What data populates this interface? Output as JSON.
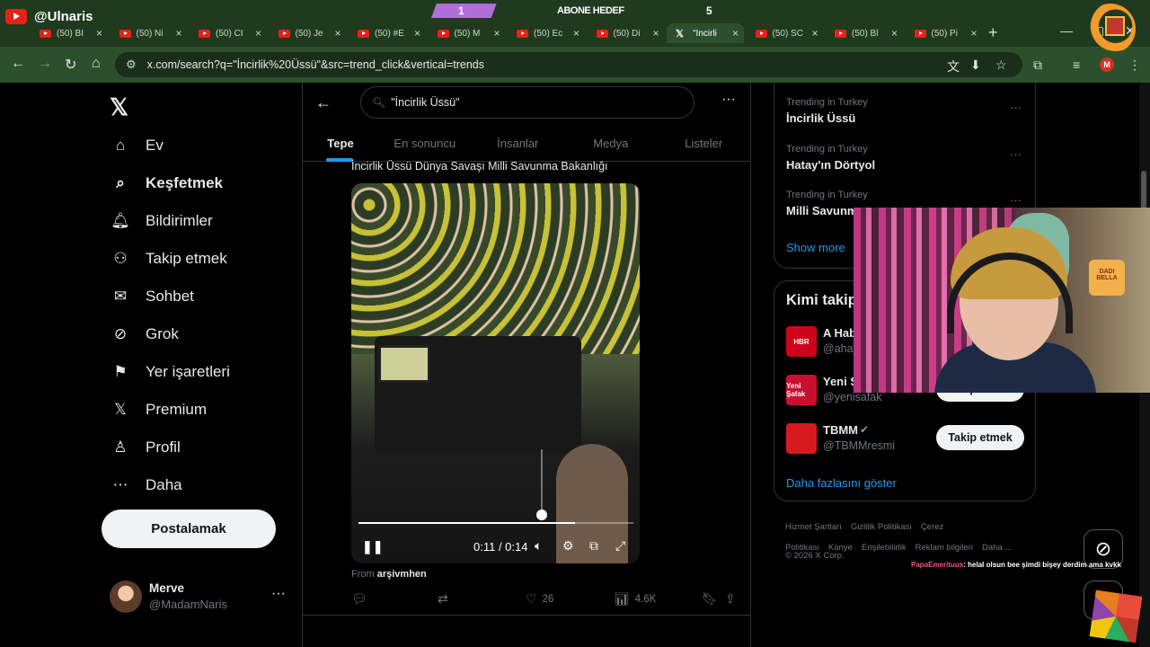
{
  "stream": {
    "channel": "@Ulnaris",
    "goal_left": "1",
    "goal_title": "ABONE HEDEF",
    "goal_right": "5",
    "goal_progress": 0.22,
    "chat": {
      "user": "PapaEmerituus",
      "text": ": helal olsun bee şimdi bişey derdim ama kvkk"
    }
  },
  "browser": {
    "tabs": [
      {
        "icon": "youtube-icon",
        "title": "(50) BI"
      },
      {
        "icon": "youtube-icon",
        "title": "(50) Ni"
      },
      {
        "icon": "youtube-icon",
        "title": "(50) CI"
      },
      {
        "icon": "youtube-icon",
        "title": "(50) Je"
      },
      {
        "icon": "youtube-icon",
        "title": "(50) #E"
      },
      {
        "icon": "youtube-icon",
        "title": "(50) M"
      },
      {
        "icon": "youtube-icon",
        "title": "(50) Ec"
      },
      {
        "icon": "youtube-icon",
        "title": "(50) Di"
      },
      {
        "icon": "x-icon",
        "title": "\"İncirli",
        "active": true
      },
      {
        "icon": "youtube-icon",
        "title": "(50) SC"
      },
      {
        "icon": "youtube-icon",
        "title": "(50) Bl"
      },
      {
        "icon": "youtube-icon",
        "title": "(50) Pi"
      }
    ],
    "url": "x.com/search?q=\"İncirlik%20Üssü\"&src=trend_click&vertical=trends",
    "profile_initial": "M"
  },
  "nav": {
    "items": [
      {
        "label": "Ev",
        "icon": "home-icon"
      },
      {
        "label": "Keşfetmek",
        "icon": "search-icon",
        "bold": true
      },
      {
        "label": "Bildirimler",
        "icon": "bell-icon"
      },
      {
        "label": "Takip etmek",
        "icon": "person-add-icon"
      },
      {
        "label": "Sohbet",
        "icon": "mail-icon"
      },
      {
        "label": "Grok",
        "icon": "grok-icon"
      },
      {
        "label": "Yer işaretleri",
        "icon": "bookmark-icon"
      },
      {
        "label": "Premium",
        "icon": "x-icon"
      },
      {
        "label": "Profil",
        "icon": "profile-icon"
      },
      {
        "label": "Daha",
        "icon": "more-circle-icon"
      }
    ],
    "post_button": "Postalamak",
    "user": {
      "name": "Merve",
      "handle": "@MadamNaris"
    }
  },
  "search": {
    "value": "\"İncirlik Üssü\"",
    "tabs": [
      "Tepe",
      "En sonuncu",
      "İnsanlar",
      "Medya",
      "Listeler"
    ]
  },
  "tweet": {
    "text": "İncirlik Üssü Dünya Savaşı Milli Savunma Bakanlığı",
    "video_time": "0:11 / 0:14",
    "progress": 0.786,
    "volume": 0.1,
    "from_label": "From",
    "from_source": "arşivmhen",
    "likes": "26",
    "views": "4.6K"
  },
  "trends": [
    {
      "category": "Trending in Turkey",
      "name": "İncirlik Üssü"
    },
    {
      "category": "Trending in Turkey",
      "name": "Hatay'ın Dörtyol"
    },
    {
      "category": "Trending in Turkey",
      "name": "Milli Savunm"
    }
  ],
  "trends_show_more": "Show more",
  "who_to_follow": {
    "title": "Kimi takip",
    "accounts": [
      {
        "name": "A Hab",
        "handle": "@ahab",
        "avatar_text": "HBR",
        "color": "#d0021b",
        "button": ""
      },
      {
        "name": "Yeni Ş",
        "handle": "@yenisafak",
        "avatar_text": "Yeni Şafak",
        "color": "#c8102e",
        "button": "Takip etmek"
      },
      {
        "name": "TBMM",
        "handle": "@TBMMresmi",
        "avatar_text": "",
        "color": "#d71920",
        "button": "Takip etmek",
        "verified": true
      }
    ],
    "show_more": "Daha fazlasını göster"
  },
  "footer": {
    "links": [
      "Hizmet Şartları",
      "Gizlilik Politikası",
      "Çerez Politikası",
      "Künye",
      "Erişilebilirlik",
      "Reklam bilgileri",
      "Daha ..."
    ],
    "copyright": "© 2026 X Corp."
  }
}
